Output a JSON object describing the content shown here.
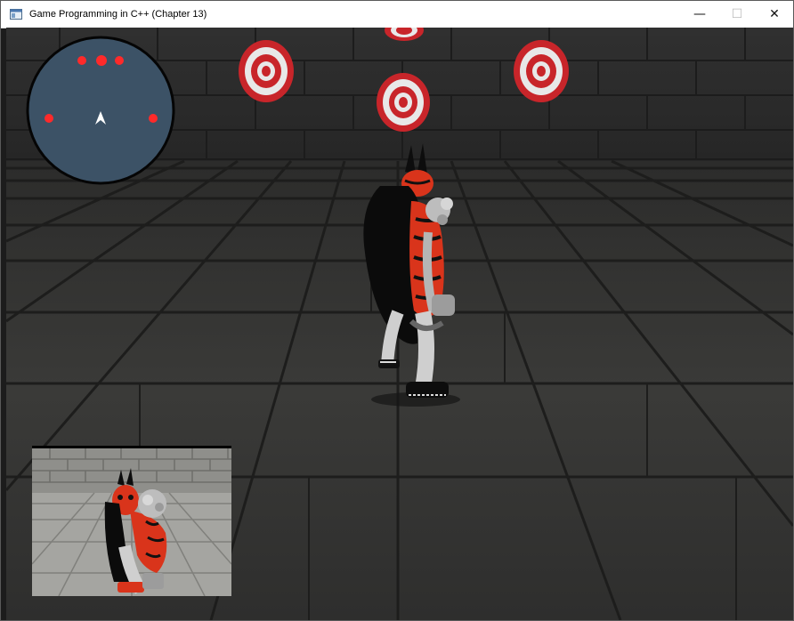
{
  "window": {
    "title": "Game Programming in C++ (Chapter 13)",
    "minimize_glyph": "—",
    "maximize_glyph": "☐",
    "close_glyph": "✕"
  },
  "icons": {
    "app": "window-app-icon",
    "minimize": "minimize-icon",
    "maximize": "maximize-icon",
    "close": "close-icon"
  },
  "hud": {
    "radar": {
      "blip_color": "#ff2a2a",
      "player_arrow_color": "#ffffff",
      "background_color": "#3c5266",
      "blip_count": 5
    },
    "mirror_view": {
      "description_color": "#9a9a9a"
    }
  },
  "scene": {
    "floor_color": "#3a3a38",
    "wall_color": "#4a4a47",
    "target_colors": [
      "#c8252a",
      "#e8e8e8"
    ],
    "character_colors": [
      "#d9341b",
      "#111111",
      "#bdbdbd"
    ]
  }
}
